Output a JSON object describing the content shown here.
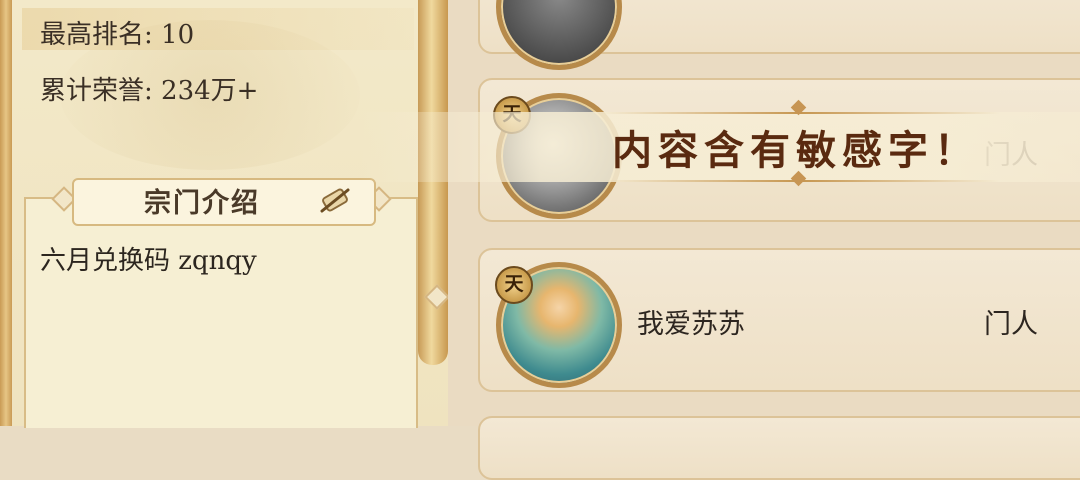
{
  "guild_info": {
    "highest_rank": "最高排名: 10",
    "total_honor": "累计荣誉: 234万+"
  },
  "intro": {
    "title": "宗门介绍",
    "text": "六月兑换码 zqnqy"
  },
  "members": [
    {
      "badge": "",
      "name": "",
      "role": ""
    },
    {
      "badge": "天",
      "name": "",
      "role": "门人"
    },
    {
      "badge": "天",
      "name": "我爱苏苏",
      "role": "门人"
    }
  ],
  "toast": {
    "message": "内容含有敏感字！"
  },
  "icons": {
    "intro_header_icon": "scroll-brush-icon",
    "member_badge_icon": "tian-rank-badge"
  },
  "colors": {
    "accent_gold": "#c99b55",
    "toast_text": "#5a2a10"
  }
}
